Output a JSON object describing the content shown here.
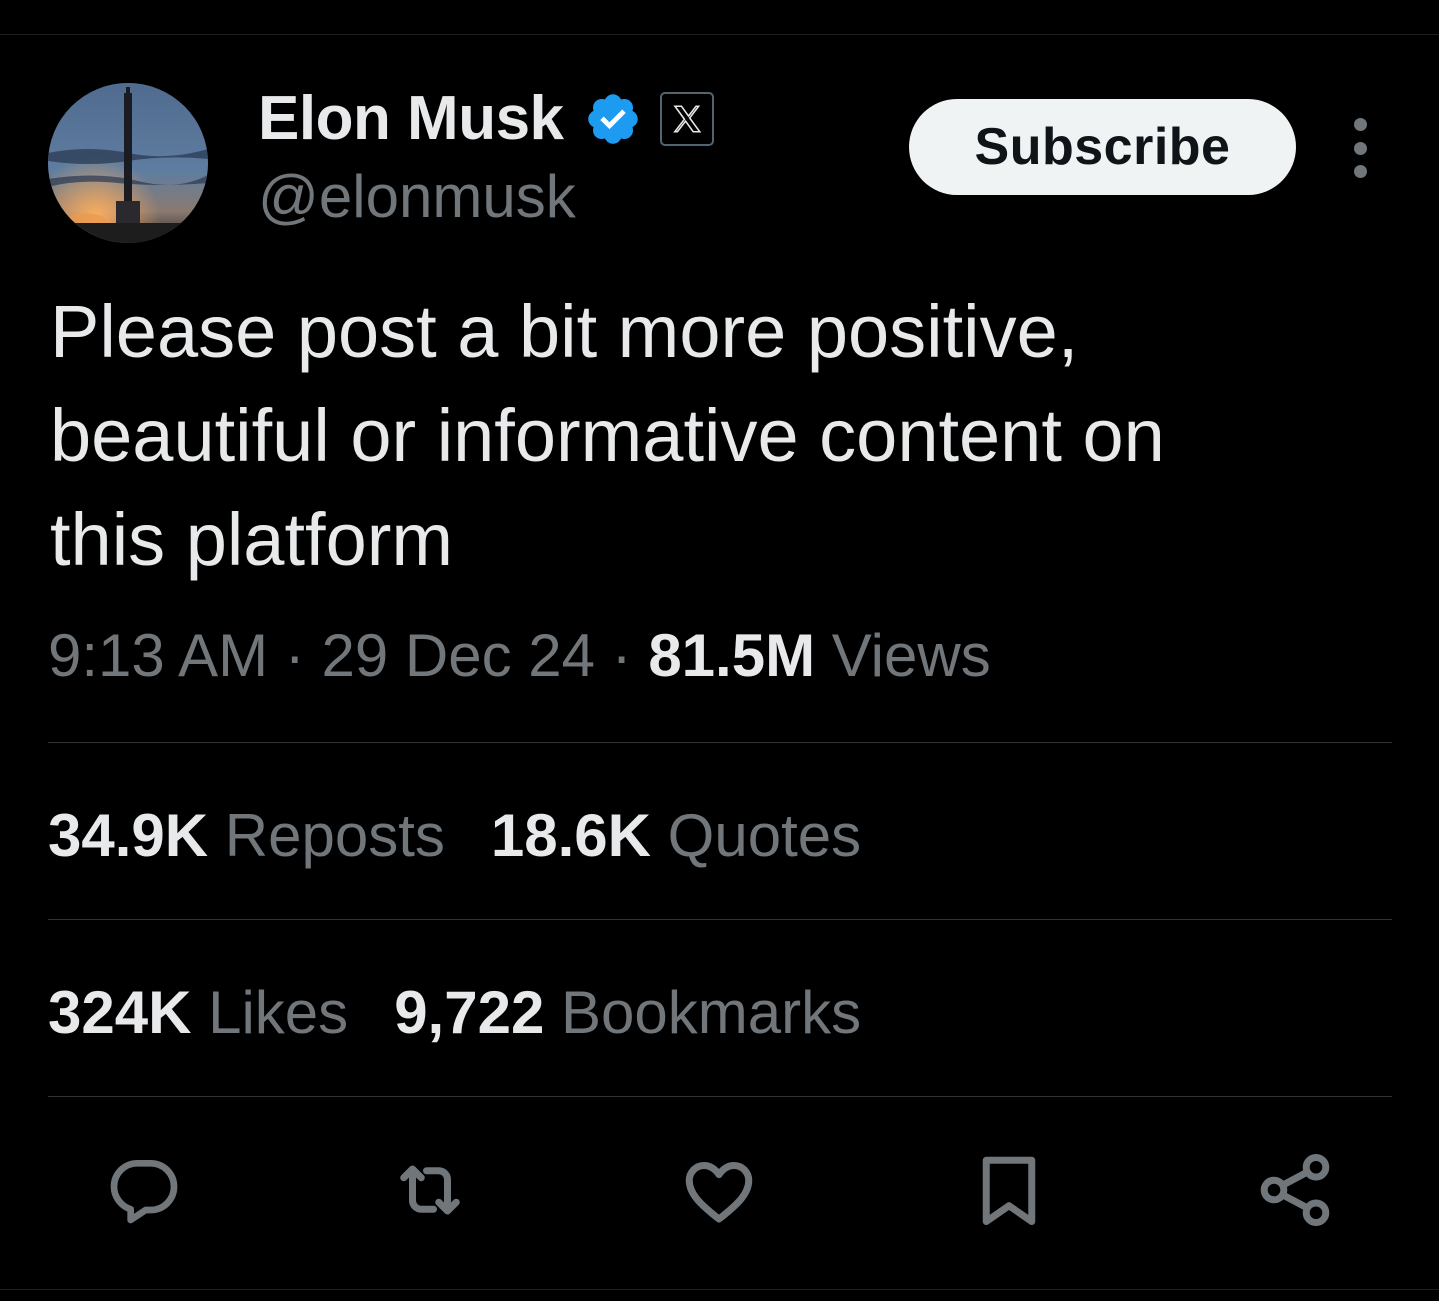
{
  "author": {
    "display_name": "Elon Musk",
    "handle": "@elonmusk",
    "verified": true,
    "affiliate_badge": "x-logo-icon",
    "avatar": "starship-launch-tower-avatar"
  },
  "header": {
    "subscribe_label": "Subscribe",
    "more_icon": "more-vertical-icon"
  },
  "post": {
    "text": "Please post a bit more positive,\nbeautiful or informative content on\nthis platform",
    "time": "9:13 AM",
    "separator": " · ",
    "date": "29 Dec 24",
    "views_count": "81.5M",
    "views_label": " Views"
  },
  "stats": {
    "reposts_count": "34.9K",
    "reposts_label": " Reposts",
    "quotes_count": "18.6K",
    "quotes_label": " Quotes",
    "likes_count": "324K",
    "likes_label": " Likes",
    "bookmarks_count": "9,722",
    "bookmarks_label": " Bookmarks"
  },
  "actions": [
    "reply-icon",
    "repost-icon",
    "like-icon",
    "bookmark-icon",
    "share-icon"
  ],
  "colors": {
    "background": "#000000",
    "primary_text": "#e7e9ea",
    "secondary_text": "#71767b",
    "divider": "#2f3336",
    "verified_blue": "#1d9bf0",
    "button_bg": "#eff3f4"
  }
}
